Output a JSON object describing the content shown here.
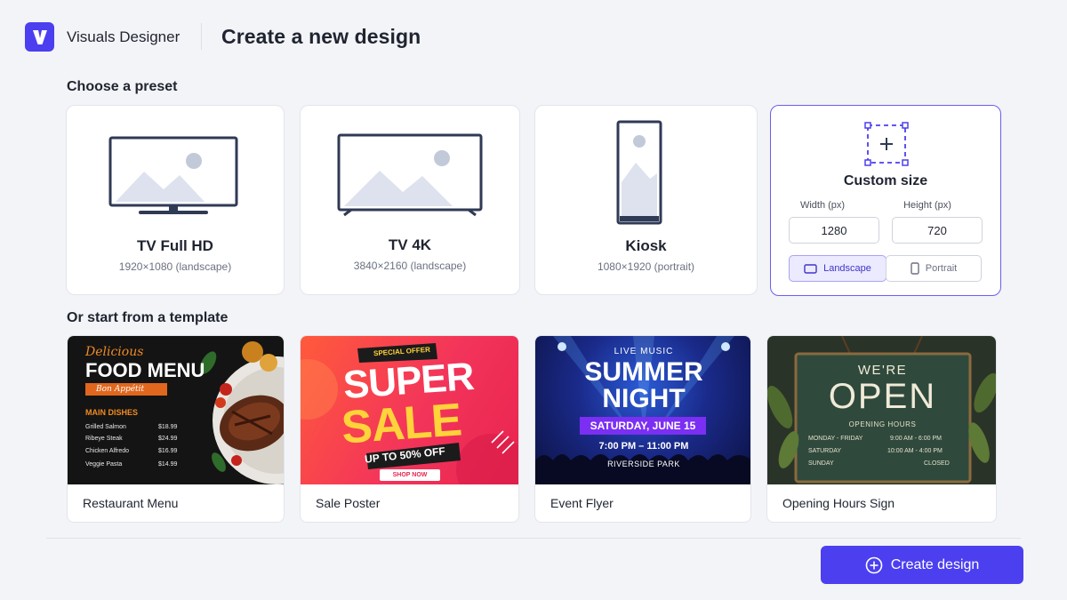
{
  "header": {
    "logo_letter": "V",
    "app_name": "Visuals Designer",
    "page_title": "Create a new design"
  },
  "presets": {
    "section_label": "Choose a preset",
    "items": [
      {
        "name": "TV Full HD",
        "dims": "1920×1080 (landscape)",
        "icon": "tv-icon"
      },
      {
        "name": "TV 4K",
        "dims": "3840×2160 (landscape)",
        "icon": "tv-4k-icon"
      },
      {
        "name": "Kiosk",
        "dims": "1080×1920 (portrait)",
        "icon": "kiosk-icon"
      }
    ],
    "custom": {
      "title": "Custom size",
      "width_label": "Width (px)",
      "height_label": "Height (px)",
      "width_value": "1280",
      "height_value": "720",
      "landscape_label": "Landscape",
      "portrait_label": "Portrait",
      "selected_orientation": "Landscape"
    }
  },
  "templates": {
    "section_label": "Or start from a template",
    "items": [
      {
        "name": "Restaurant Menu",
        "thumb": {
          "script_title": "Delicious",
          "title": "FOOD MENU",
          "ribbon": "Bon Appétit",
          "section": "MAIN DISHES",
          "rows": [
            {
              "item": "Grilled Salmon",
              "price": "$18.99"
            },
            {
              "item": "Ribeye Steak",
              "price": "$24.99"
            },
            {
              "item": "Chicken Alfredo",
              "price": "$16.99"
            },
            {
              "item": "Veggie Pasta",
              "price": "$14.99"
            }
          ]
        }
      },
      {
        "name": "Sale Poster",
        "thumb": {
          "tag": "SPECIAL OFFER",
          "line1": "SUPER",
          "line2": "SALE",
          "discount": "UP TO 50% OFF",
          "cta": "SHOP NOW"
        }
      },
      {
        "name": "Event Flyer",
        "thumb": {
          "kicker": "LIVE MUSIC",
          "line1": "SUMMER",
          "line2": "NIGHT",
          "date": "SATURDAY, JUNE 15",
          "time": "7:00 PM – 11:00 PM",
          "venue": "RIVERSIDE PARK"
        }
      },
      {
        "name": "Opening Hours Sign",
        "thumb": {
          "line1": "WE'RE",
          "line2": "OPEN",
          "subtitle": "OPENING HOURS",
          "rows": [
            {
              "days": "MONDAY - FRIDAY",
              "hours": "9:00 AM - 6:00 PM"
            },
            {
              "days": "SATURDAY",
              "hours": "10:00 AM - 4:00 PM"
            },
            {
              "days": "SUNDAY",
              "hours": "CLOSED"
            }
          ]
        }
      }
    ]
  },
  "footer": {
    "create_label": "Create design"
  },
  "colors": {
    "accent": "#4b3ff0",
    "accent_soft": "#eceafe",
    "background": "#f3f4f7",
    "card_border": "#e2e5ec",
    "illustration_stroke": "#2f3a55",
    "illustration_fill": "#dde2ee"
  }
}
